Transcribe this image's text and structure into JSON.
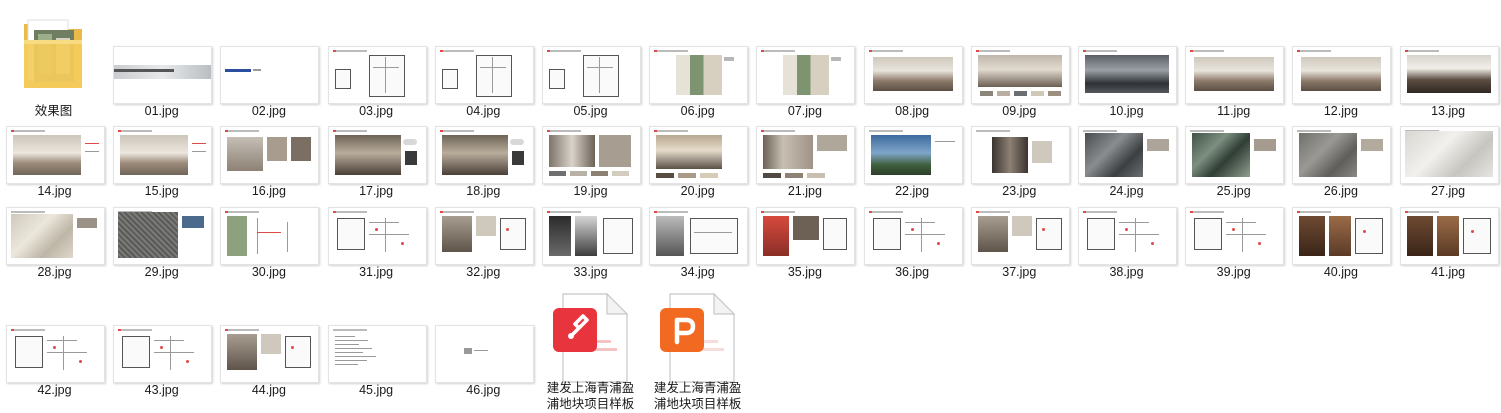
{
  "folder": {
    "label": "效果图",
    "icon": "folder-icon"
  },
  "files": [
    {
      "name": "01.jpg",
      "style": "cover"
    },
    {
      "name": "02.jpg",
      "style": "title"
    },
    {
      "name": "03.jpg",
      "style": "plan"
    },
    {
      "name": "04.jpg",
      "style": "plan"
    },
    {
      "name": "05.jpg",
      "style": "plan"
    },
    {
      "name": "06.jpg",
      "style": "room-green"
    },
    {
      "name": "07.jpg",
      "style": "room-green"
    },
    {
      "name": "08.jpg",
      "style": "living"
    },
    {
      "name": "09.jpg",
      "style": "living-swatch"
    },
    {
      "name": "10.jpg",
      "style": "living-dark"
    },
    {
      "name": "11.jpg",
      "style": "living"
    },
    {
      "name": "12.jpg",
      "style": "living"
    },
    {
      "name": "13.jpg",
      "style": "kitchen"
    },
    {
      "name": "14.jpg",
      "style": "bedroom"
    },
    {
      "name": "15.jpg",
      "style": "bedroom"
    },
    {
      "name": "16.jpg",
      "style": "bedroom-small"
    },
    {
      "name": "17.jpg",
      "style": "bedroom-dark"
    },
    {
      "name": "18.jpg",
      "style": "bedroom-dark"
    },
    {
      "name": "19.jpg",
      "style": "corridor"
    },
    {
      "name": "20.jpg",
      "style": "room-swatch"
    },
    {
      "name": "21.jpg",
      "style": "wardrobe"
    },
    {
      "name": "22.jpg",
      "style": "exterior"
    },
    {
      "name": "23.jpg",
      "style": "cabinet"
    },
    {
      "name": "24.jpg",
      "style": "marble-dark"
    },
    {
      "name": "25.jpg",
      "style": "marble-green"
    },
    {
      "name": "26.jpg",
      "style": "marble-grey"
    },
    {
      "name": "27.jpg",
      "style": "marble-white"
    },
    {
      "name": "28.jpg",
      "style": "marble-beige"
    },
    {
      "name": "29.jpg",
      "style": "stone-dark"
    },
    {
      "name": "30.jpg",
      "style": "detail-green"
    },
    {
      "name": "31.jpg",
      "style": "detail-line"
    },
    {
      "name": "32.jpg",
      "style": "detail-photo"
    },
    {
      "name": "33.jpg",
      "style": "stair"
    },
    {
      "name": "34.jpg",
      "style": "stair-light"
    },
    {
      "name": "35.jpg",
      "style": "detail-red"
    },
    {
      "name": "36.jpg",
      "style": "detail-line"
    },
    {
      "name": "37.jpg",
      "style": "detail-photo"
    },
    {
      "name": "38.jpg",
      "style": "detail-line"
    },
    {
      "name": "39.jpg",
      "style": "detail-line"
    },
    {
      "name": "40.jpg",
      "style": "detail-wood"
    },
    {
      "name": "41.jpg",
      "style": "detail-wood"
    },
    {
      "name": "42.jpg",
      "style": "detail-line"
    },
    {
      "name": "43.jpg",
      "style": "detail-line"
    },
    {
      "name": "44.jpg",
      "style": "detail-photo"
    },
    {
      "name": "45.jpg",
      "style": "text-page"
    },
    {
      "name": "46.jpg",
      "style": "end-page"
    }
  ],
  "documents": [
    {
      "label": "建发上海青浦盈浦地块项目样板",
      "label_line1": "建发上海青浦盈",
      "label_line2": "浦地块项目样板",
      "app": "wps-pdf",
      "icon": "wps-pdf-icon",
      "color": "#e8343c"
    },
    {
      "label": "建发上海青浦盈浦地块项目样板",
      "label_line1": "建发上海青浦盈",
      "label_line2": "浦地块项目样板",
      "app": "powerpoint",
      "icon": "powerpoint-icon",
      "color": "#f26a21"
    }
  ]
}
